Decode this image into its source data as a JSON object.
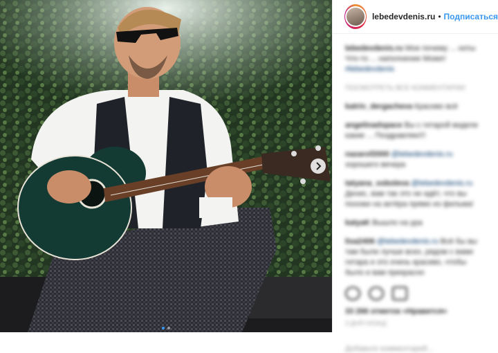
{
  "post": {
    "username": "lebedevdenis.ru",
    "separator": "•",
    "follow_label": "Подписаться",
    "colors": {
      "accent": "#3897f0",
      "text": "#262626",
      "muted": "#999999"
    },
    "carousel": {
      "slides": 2,
      "active": 1,
      "next_icon": "chevron-right-icon"
    }
  },
  "comments": [
    {
      "user": "lebedevdenis.ru",
      "text": "Мое почему ... ноты Что-то ... наполнение Может",
      "tag": "#lebedevdenis"
    },
    {
      "meta": "ПОСМОТРЕТЬ ВСЕ КОММЕНТАРИИ"
    },
    {
      "user": "katrin_dergacheva",
      "text": "Красиво всё"
    },
    {
      "user": "angelinadspace",
      "text": "Вы с гитарой видели какие ... Поздравляю!!!"
    },
    {
      "user": "nazarof2000",
      "text": "хорошего вечера",
      "tag": "@lebedevdenis.ru"
    },
    {
      "user": "tatyana_soboleva",
      "text": "Денис, вам так это не идёт, что вы похожи на актёра прямо из фильма!",
      "tag": "@lebedevdenis.ru"
    },
    {
      "user": "katyaK",
      "text": "Вышло на ура"
    },
    {
      "user": "lisa2406",
      "text": "Всё бы вы там были лучше всех, рядом с вами гитара и это очень красиво, чтобы было и вам прекрасно",
      "tag": "@lebedevdenis.ru"
    }
  ],
  "actions": [
    "heart-icon",
    "comment-icon",
    "share-icon"
  ],
  "likes": "33 266 отметок «Нравится»",
  "date": "3 ДНЯ НАЗАД",
  "footer": "Добавьте комментарий..."
}
